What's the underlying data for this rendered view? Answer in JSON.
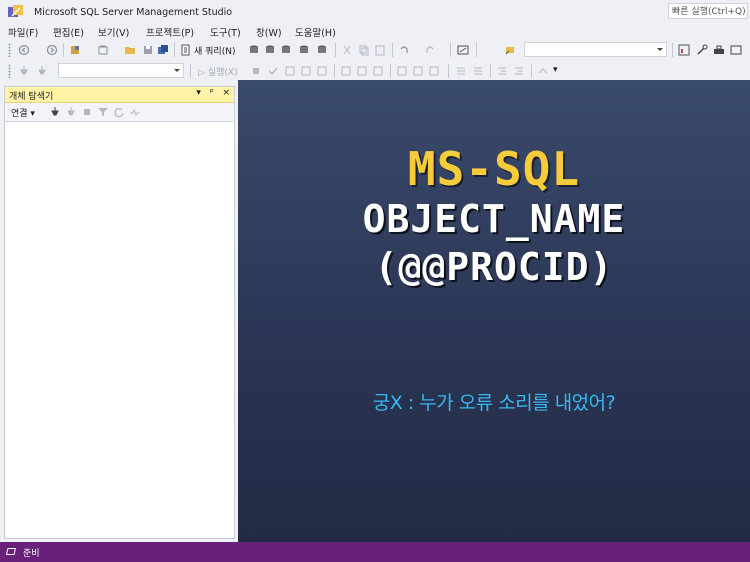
{
  "window": {
    "title": "Microsoft SQL Server Management Studio",
    "quick_launch_placeholder": "빠른 실행(Ctrl+Q)"
  },
  "menu": [
    "파일(F)",
    "편집(E)",
    "보기(V)",
    "프로젝트(P)",
    "도구(T)",
    "창(W)",
    "도움말(H)"
  ],
  "toolbar": {
    "new_query": "새 쿼리(N)",
    "execute": "실행(X)",
    "database_combo_value": "",
    "search_combo_value": ""
  },
  "object_explorer": {
    "title": "개체 탐색기",
    "connect_label": "연결",
    "controls": [
      "▾",
      "ᵖ",
      "×"
    ]
  },
  "banner": {
    "line1": "MS-SQL",
    "line2": "OBJECT_NAME",
    "line3": "(@@PROCID)",
    "subtitle": "궁X : 누가 오류 소리를 내었어?",
    "colors": {
      "line1": "#f6cc3b",
      "lines": "#ffffff",
      "subtitle": "#38b8f2",
      "background": "#2b3655"
    }
  },
  "status": {
    "text": "준비",
    "color": "#68217a"
  }
}
